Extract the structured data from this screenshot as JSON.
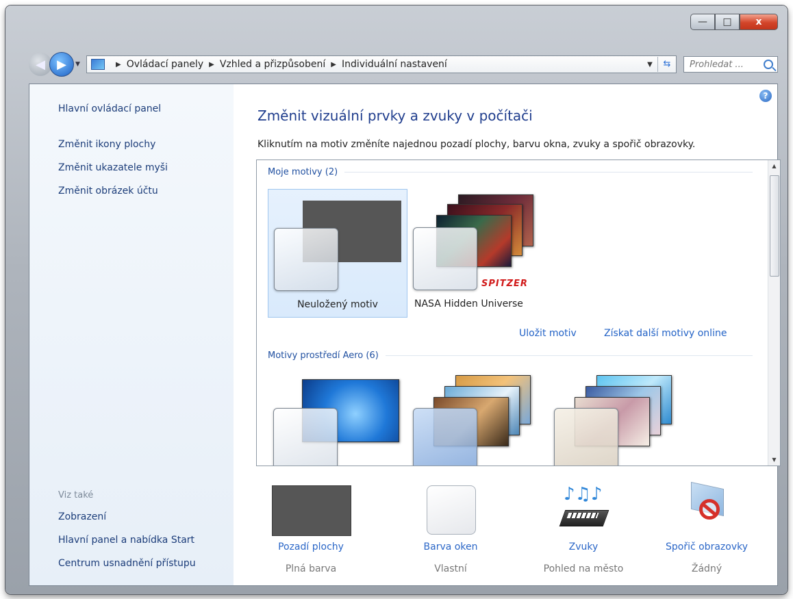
{
  "window": {
    "controls": {
      "minimize": "—",
      "maximize": "□",
      "close": "x"
    }
  },
  "nav": {
    "back_glyph": "◀",
    "forward_glyph": "▶",
    "breadcrumbs": [
      "Ovládací panely",
      "Vzhled a přizpůsobení",
      "Individuální nastavení"
    ],
    "search_placeholder": "Prohledat ..."
  },
  "sidebar": {
    "main_link": "Hlavní ovládací panel",
    "links": [
      "Změnit ikony plochy",
      "Změnit ukazatele myši",
      "Změnit obrázek účtu"
    ],
    "see_also_heading": "Viz také",
    "see_also_links": [
      "Zobrazení",
      "Hlavní panel a nabídka Start",
      "Centrum usnadnění přístupu"
    ]
  },
  "main": {
    "title": "Změnit vizuální prvky a zvuky v počítači",
    "description": "Kliknutím na motiv změníte najednou pozadí plochy, barvu okna, zvuky a spořič obrazovky.",
    "groups": {
      "my_themes": {
        "heading": "Moje motivy (2)",
        "themes": [
          {
            "name": "Neuložený motiv",
            "selected": true
          },
          {
            "name": "NASA Hidden Universe",
            "brand": "SPITZER"
          }
        ],
        "save_link": "Uložit motiv",
        "online_link": "Získat další motivy online"
      },
      "aero_themes": {
        "heading": "Motivy prostředí Aero (6)"
      }
    },
    "settings": [
      {
        "title": "Pozadí plochy",
        "value": "Plná barva",
        "icon": "desktop-background-icon"
      },
      {
        "title": "Barva oken",
        "value": "Vlastní",
        "icon": "window-color-icon"
      },
      {
        "title": "Zvuky",
        "value": "Pohled na město",
        "icon": "sounds-icon"
      },
      {
        "title": "Spořič obrazovky",
        "value": "Žádný",
        "icon": "screensaver-icon"
      }
    ]
  },
  "colors": {
    "link_blue": "#2262c6",
    "title_blue": "#1f3d8d",
    "background_swatch": "#565656"
  }
}
